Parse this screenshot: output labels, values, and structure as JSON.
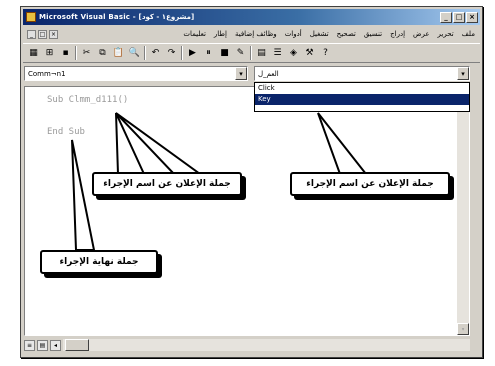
{
  "window": {
    "title": "Microsoft Visual Basic - [مشروع١ - كود]",
    "buttons": {
      "minimize": "_",
      "restore": "□",
      "close": "×"
    }
  },
  "menubar": {
    "items": [
      "ملف",
      "تحرير",
      "عرض",
      "إدراج",
      "تنسيق",
      "تصحيح",
      "تشغيل",
      "أدوات",
      "وظائف إضافية",
      "إطار",
      "تعليمات"
    ],
    "window_controls": {
      "minimize": "_",
      "restore": "□",
      "close": "×"
    }
  },
  "toolbar": {
    "icons": [
      "view-icon",
      "insert-icon",
      "save-icon",
      "cut-icon",
      "copy-icon",
      "paste-icon",
      "find-icon",
      "undo-icon",
      "redo-icon",
      "run-icon",
      "pause-icon",
      "stop-icon",
      "design-icon",
      "project-icon",
      "properties-icon",
      "object-browser-icon",
      "toolbox-icon",
      "help-icon"
    ],
    "glyphs": [
      "▦",
      "⊞",
      "▪",
      "✂",
      "⧉",
      "📋",
      "🔍",
      "↶",
      "↷",
      "▶",
      "⏸",
      "■",
      "✎",
      "▤",
      "☰",
      "◈",
      "⚒",
      "?"
    ]
  },
  "object_combo": {
    "value": "Comm¬n1",
    "arrow": "▾"
  },
  "procedure_combo": {
    "value": "العم_ل",
    "arrow": "▾"
  },
  "dropdown": {
    "options": [
      "Click",
      "Key"
    ],
    "selected_index": 1
  },
  "code": {
    "sub_line": "Sub Clmm_d111()",
    "end_line": "End Sub"
  },
  "scrollbar": {
    "up": "▴",
    "down": "▾"
  },
  "status": {
    "view_buttons": [
      "≡",
      "▤"
    ],
    "left_arrow": "◂"
  },
  "callouts": {
    "end_label": "جملة نهاية الإجراء",
    "start_label_1": "جملة الإعلان عن اسم الإجراء",
    "start_label_2": "جملة الإعلان عن اسم الإجراء"
  }
}
